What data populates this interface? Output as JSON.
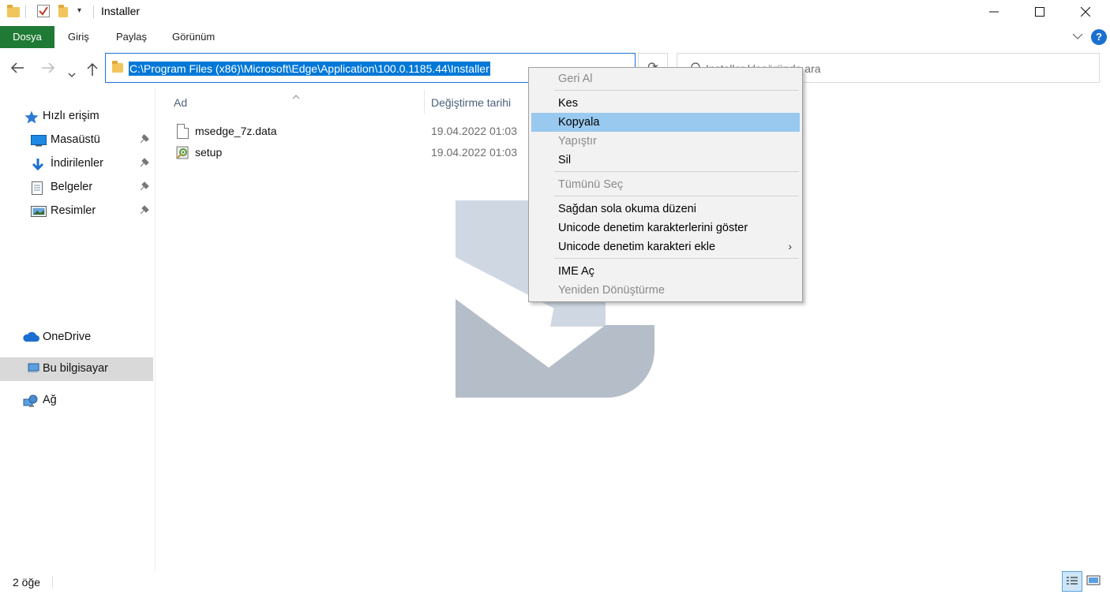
{
  "window": {
    "title": "Installer",
    "minimize_glyph": "—",
    "maximize_glyph": "☐",
    "close_glyph": "✕"
  },
  "ribbon": {
    "tabs": [
      "Dosya",
      "Giriş",
      "Paylaş",
      "Görünüm"
    ],
    "help_glyph": "?"
  },
  "address": {
    "path": "C:\\Program Files (x86)\\Microsoft\\Edge\\Application\\100.0.1185.44\\Installer",
    "refresh_glyph": "⟳"
  },
  "search": {
    "placeholder": "Installer klasöründe ara"
  },
  "sidebar": {
    "quick_access": "Hızlı erişim",
    "quick_items": [
      "Masaüstü",
      "İndirilenler",
      "Belgeler",
      "Resimler"
    ],
    "onedrive": "OneDrive",
    "this_pc": "Bu bilgisayar",
    "network": "Ağ"
  },
  "columns": {
    "name": "Ad",
    "modified": "Değiştirme tarihi"
  },
  "files": [
    {
      "name": "msedge_7z.data",
      "date": "19.04.2022 01:03",
      "icon": "data-file-icon"
    },
    {
      "name": "setup",
      "date": "19.04.2022 01:03",
      "icon": "setup-exe-icon"
    }
  ],
  "context_menu": {
    "undo": "Geri Al",
    "cut": "Kes",
    "copy": "Kopyala",
    "paste": "Yapıştır",
    "delete": "Sil",
    "select_all": "Tümünü Seç",
    "rtl": "Sağdan sola okuma düzeni",
    "show_unicode": "Unicode denetim karakterlerini göster",
    "insert_unicode": "Unicode denetim karakteri ekle",
    "ime_open": "IME Aç",
    "reconversion": "Yeniden Dönüştürme",
    "submenu_glyph": "›"
  },
  "status": {
    "item_count": "2 öğe"
  },
  "colors": {
    "file_tab": "#1e7a34",
    "selection": "#0078d7",
    "menu_highlight": "#99c9ef",
    "selected_nav": "#d9d9d9"
  }
}
